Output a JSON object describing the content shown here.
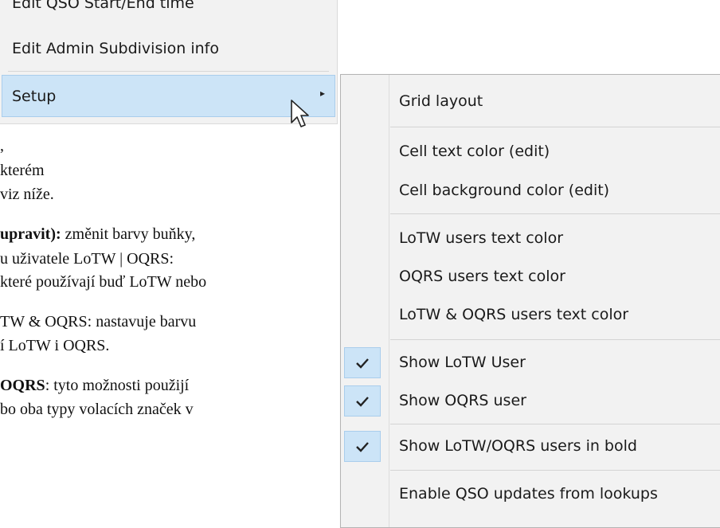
{
  "document": {
    "lines": [
      ",",
      " kterém",
      "viz níže.",
      "upravit): změnit barvy buňky,",
      "u uživatele LoTW | OQRS:",
      "které používají buď LoTW nebo",
      "TW & OQRS: nastavuje barvu",
      "í LoTW i OQRS.",
      "OQRS: tyto možnosti použijí",
      "bo oba typy volacích značek v"
    ]
  },
  "parent_menu": {
    "edit_qso_time": "Edit QSO Start/End time",
    "edit_admin": "Edit Admin Subdivision info",
    "setup": "Setup",
    "submenu_arrow": "▸"
  },
  "submenu": {
    "grid_layout": "Grid layout",
    "cell_text_color": "Cell text color (edit)",
    "cell_bg_color": "Cell background color (edit)",
    "lotw_text_color": "LoTW users text color",
    "oqrs_text_color": "OQRS users text color",
    "lotw_oqrs_text_color": "LoTW & OQRS users text color",
    "show_lotw_user": "Show LoTW User",
    "show_oqrs_user": "Show OQRS user",
    "show_bold": "Show LoTW/OQRS users in bold",
    "enable_qso_updates": "Enable QSO updates from lookups",
    "checks": {
      "show_lotw_user": true,
      "show_oqrs_user": true,
      "show_bold": true
    }
  },
  "colors": {
    "highlight": "#cce4f7",
    "highlight_border": "#a9cdec",
    "menu_bg": "#f2f2f2"
  }
}
